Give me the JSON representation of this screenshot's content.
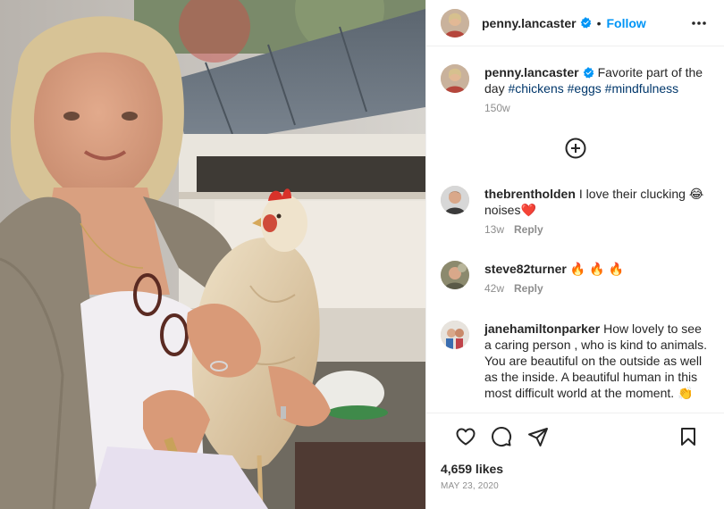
{
  "post": {
    "username": "penny.lancaster",
    "follow_label": "Follow",
    "separator": "•",
    "caption": {
      "username": "penny.lancaster",
      "text_before": "Favorite part of the day ",
      "hashtags": [
        "#chickens",
        "#eggs",
        "#mindfulness"
      ],
      "time": "150w"
    },
    "comments": [
      {
        "username": "thebrentholden",
        "text": "I love their clucking 😂 noises❤️",
        "time": "13w",
        "reply_label": "Reply"
      },
      {
        "username": "steve82turner",
        "text": "🔥 🔥 🔥",
        "time": "42w",
        "reply_label": "Reply"
      },
      {
        "username": "janehamiltonparker",
        "text": "How lovely to see a caring person , who is kind to animals. You are beautiful on the outside as well as the inside. A beautiful human in this most difficult world at the moment. 👏"
      }
    ],
    "likes": "4,659 likes",
    "date": "MAY 23, 2020"
  },
  "icons": {
    "more": "more-options-icon",
    "load_more": "plus-circle-icon",
    "like": "heart-icon",
    "comment": "comment-icon",
    "share": "paper-plane-icon",
    "save": "bookmark-icon",
    "verified": "verified-badge-icon"
  },
  "colors": {
    "accent": "#0095f6",
    "hashtag": "#00376b",
    "muted": "#8e8e8e",
    "verified": "#0095f6"
  }
}
